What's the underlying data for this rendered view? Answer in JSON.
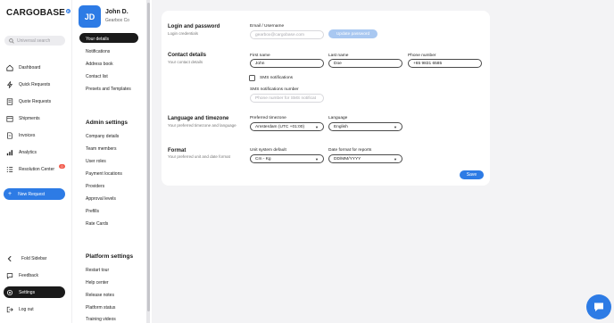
{
  "brand": {
    "name": "CARGOBASE",
    "reg_mark": "R"
  },
  "search": {
    "placeholder": "Universal search"
  },
  "nav": {
    "dashboard": "Dashboard",
    "quick_requests": "Quick Requests",
    "quote_requests": "Quote Requests",
    "shipments": "Shipments",
    "invoices": "Invoices",
    "analytics": "Analytics",
    "resolution_center": "Resolution Center",
    "resolution_badge": "0",
    "new_request": "New Request",
    "new_request_plus": "+",
    "fold_sidebar": "Fold Sidebar",
    "feedback": "Feedback",
    "settings": "Settings",
    "log_out": "Log out"
  },
  "user": {
    "initials": "JD",
    "name": "John D.",
    "company": "Gearbox Co"
  },
  "settings_nav": {
    "profile_links": [
      "Your details",
      "Notifications",
      "Address book",
      "Contact list",
      "Presets and Templates"
    ],
    "admin_heading": "Admin settings",
    "admin_links": [
      "Company details",
      "Team members",
      "User roles",
      "Payment locations",
      "Providers",
      "Approval levels",
      "Prefills",
      "Rate Cards"
    ],
    "platform_heading": "Platform settings",
    "platform_links": [
      "Restart tour",
      "Help center",
      "Release notes",
      "Platform status",
      "Training videos"
    ]
  },
  "login": {
    "title": "Login and password",
    "subtitle": "Login credentials",
    "email_label": "Email / Username",
    "email_value": "gearbox@cargobase.com",
    "update_password": "Update password"
  },
  "contact": {
    "title": "Contact details",
    "subtitle": "Your contact details",
    "first_name_label": "First name",
    "first_name_value": "John",
    "last_name_label": "Last name",
    "last_name_value": "Doe",
    "phone_label": "Phone number",
    "phone_value": "+65 9831 6585",
    "sms_label": "SMS notifications",
    "sms_checked": false,
    "sms_number_label": "SMS notifications number",
    "sms_number_placeholder": "Phone number for SMS notificat"
  },
  "language": {
    "title": "Language and timezone",
    "subtitle": "Your preferred timezone and language",
    "timezone_label": "Preferred timezone",
    "timezone_value": "Amsterdam (UTC +01:00)",
    "language_label": "Language",
    "language_value": "English"
  },
  "format": {
    "title": "Format",
    "subtitle": "Your preferred unit and date format",
    "unit_label": "Unit system default",
    "unit_value": "Cm - Kg",
    "date_label": "Date format for reports",
    "date_value": "DD/MM/YYYY"
  },
  "actions": {
    "save": "Save"
  },
  "colors": {
    "accent": "#2d7be5",
    "dark": "#1a1a1a",
    "badge": "#f25c4d"
  }
}
